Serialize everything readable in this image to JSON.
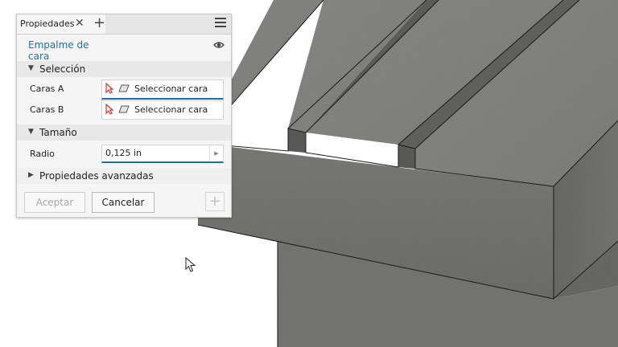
{
  "panel": {
    "tab_label": "Propiedades",
    "feature_name": "Empalme de cara",
    "sections": {
      "selection": {
        "label": "Selección"
      },
      "size": {
        "label": "Tamaño"
      },
      "advanced": {
        "label": "Propiedades avanzadas"
      }
    },
    "fields": {
      "faces_a": {
        "label": "Caras A",
        "value": "Seleccionar cara"
      },
      "faces_b": {
        "label": "Caras B",
        "value": "Seleccionar cara"
      },
      "radius": {
        "label": "Radio",
        "value": "0,125 in"
      }
    },
    "buttons": {
      "accept": "Aceptar",
      "cancel": "Cancelar"
    }
  },
  "colors": {
    "accent": "#1b6fb5",
    "select_arrow": "#d9322b",
    "model_gray": "#7d7d7b"
  },
  "icons": [
    "close-icon",
    "plus-icon",
    "hamburger-menu-icon",
    "eye-icon",
    "select-arrow-icon",
    "face-icon",
    "spinner-icon",
    "mouse-cursor-icon"
  ]
}
